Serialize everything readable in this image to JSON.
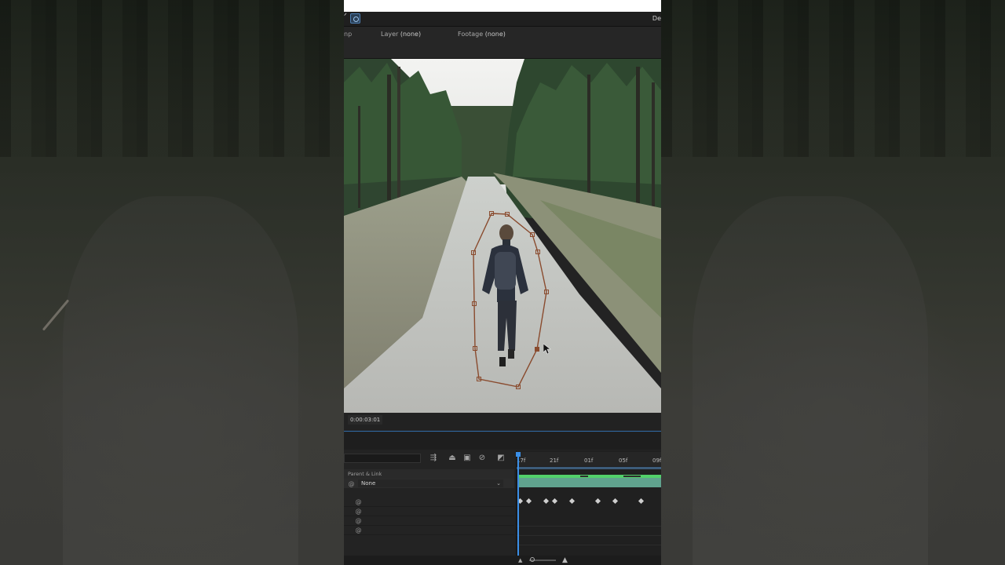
{
  "window": {
    "toolbar_left_mark": "ᐟ",
    "toolbar_right_text": "De"
  },
  "panel_header": {
    "cut_tab": "np",
    "layer_label": "Layer",
    "layer_value": "(none)",
    "footage_label": "Footage",
    "footage_value": "(none)"
  },
  "viewer": {
    "timecode": "0:00:03:01",
    "mask_path_icon": "mask-path"
  },
  "timeline": {
    "search_value": "",
    "column_header": "Parent & Link",
    "parent_value": "None",
    "ruler_ticks": [
      "17f",
      "21f",
      "01f",
      "05f",
      "09f"
    ],
    "property_rows": 4,
    "keyframes_count": 8,
    "colors": {
      "playhead": "#3a8ee6",
      "layer_bar": "#60a38e",
      "layer_bar_top": "#52d06a"
    }
  }
}
